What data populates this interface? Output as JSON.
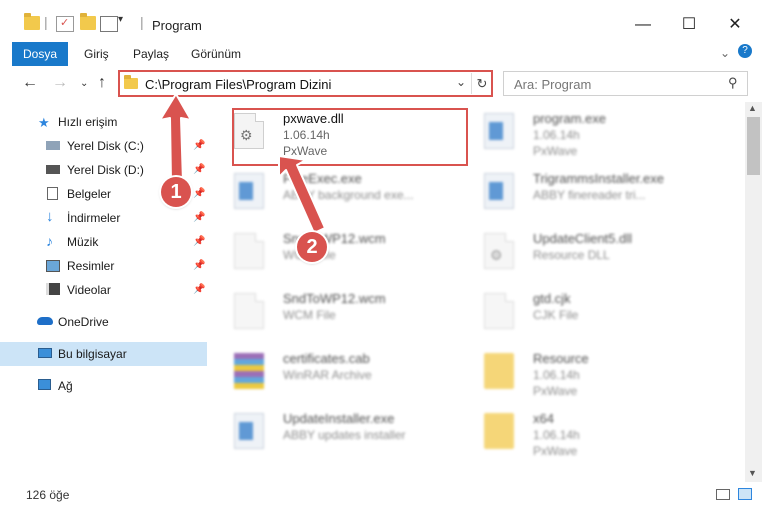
{
  "window": {
    "title": "Program",
    "minimize": "—",
    "maximize": "☐",
    "close": "✕"
  },
  "ribbon": {
    "tabs": [
      "Dosya",
      "Giriş",
      "Paylaş",
      "Görünüm"
    ]
  },
  "address": {
    "path": "C:\\Program Files\\Program Dizini",
    "search_placeholder": "Ara: Program"
  },
  "sidebar": {
    "items": [
      {
        "label": "Hızlı erişim"
      },
      {
        "label": "Yerel Disk (C:)"
      },
      {
        "label": "Yerel Disk (D:)"
      },
      {
        "label": "Belgeler"
      },
      {
        "label": "İndirmeler"
      },
      {
        "label": "Müzik"
      },
      {
        "label": "Resimler"
      },
      {
        "label": "Videolar"
      },
      {
        "label": "OneDrive"
      },
      {
        "label": "Bu bilgisayar"
      },
      {
        "label": "Ağ"
      }
    ]
  },
  "files": [
    {
      "name": "pxwave.dll",
      "line2": "1.06.14h",
      "line3": "PxWave",
      "icon": "dll-gear-icon"
    },
    {
      "name": "program.exe",
      "line2": "1.06.14h",
      "line3": "PxWave",
      "icon": "exe-icon"
    },
    {
      "name": "FineExec.exe",
      "line2": "ABBY background exe...",
      "line3": "",
      "icon": "exe-icon"
    },
    {
      "name": "TrigrammsInstaller.exe",
      "line2": "ABBY finereader tri...",
      "line3": "",
      "icon": "exe-icon"
    },
    {
      "name": "SndToWP12.wcm",
      "line2": "WCM File",
      "line3": "",
      "icon": "document-icon"
    },
    {
      "name": "UpdateClient5.dll",
      "line2": "Resource DLL",
      "line3": "",
      "icon": "dll-gear-icon"
    },
    {
      "name": "SndToWP12.wcm",
      "line2": "WCM File",
      "line3": "",
      "icon": "document-icon"
    },
    {
      "name": "gtd.cjk",
      "line2": "CJK File",
      "line3": "",
      "icon": "document-icon"
    },
    {
      "name": "certificates.cab",
      "line2": "WinRAR Archive",
      "line3": "",
      "icon": "rar-archive-icon"
    },
    {
      "name": "Resource",
      "line2": "1.06.14h",
      "line3": "PxWave",
      "icon": "folder-icon"
    },
    {
      "name": "UpdateInstaller.exe",
      "line2": "ABBY updates installer",
      "line3": "",
      "icon": "exe-icon"
    },
    {
      "name": "x64",
      "line2": "1.06.14h",
      "line3": "PxWave",
      "icon": "folder-icon"
    }
  ],
  "annotations": {
    "step1": "1",
    "step2": "2"
  },
  "status": {
    "count": "126 öğe"
  },
  "colors": {
    "accent": "#1979ca",
    "highlight": "#d9534f"
  }
}
